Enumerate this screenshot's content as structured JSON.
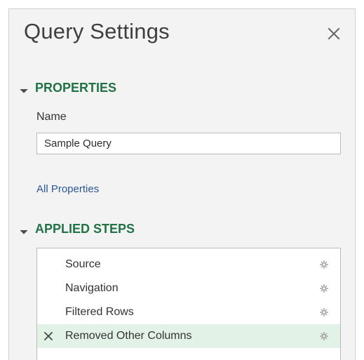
{
  "panel": {
    "title": "Query Settings",
    "close_icon": "close-icon"
  },
  "properties": {
    "heading": "PROPERTIES",
    "name_label": "Name",
    "name_value": "Sample Query",
    "all_properties_link": "All Properties"
  },
  "applied_steps": {
    "heading": "APPLIED STEPS",
    "items": [
      {
        "label": "Source",
        "selected": false
      },
      {
        "label": "Navigation",
        "selected": false
      },
      {
        "label": "Filtered Rows",
        "selected": false
      },
      {
        "label": "Removed Other Columns",
        "selected": true
      }
    ]
  },
  "colors": {
    "accent_green": "#217346",
    "link_blue": "#2b5797",
    "selected_row": "#e2f2e7"
  }
}
